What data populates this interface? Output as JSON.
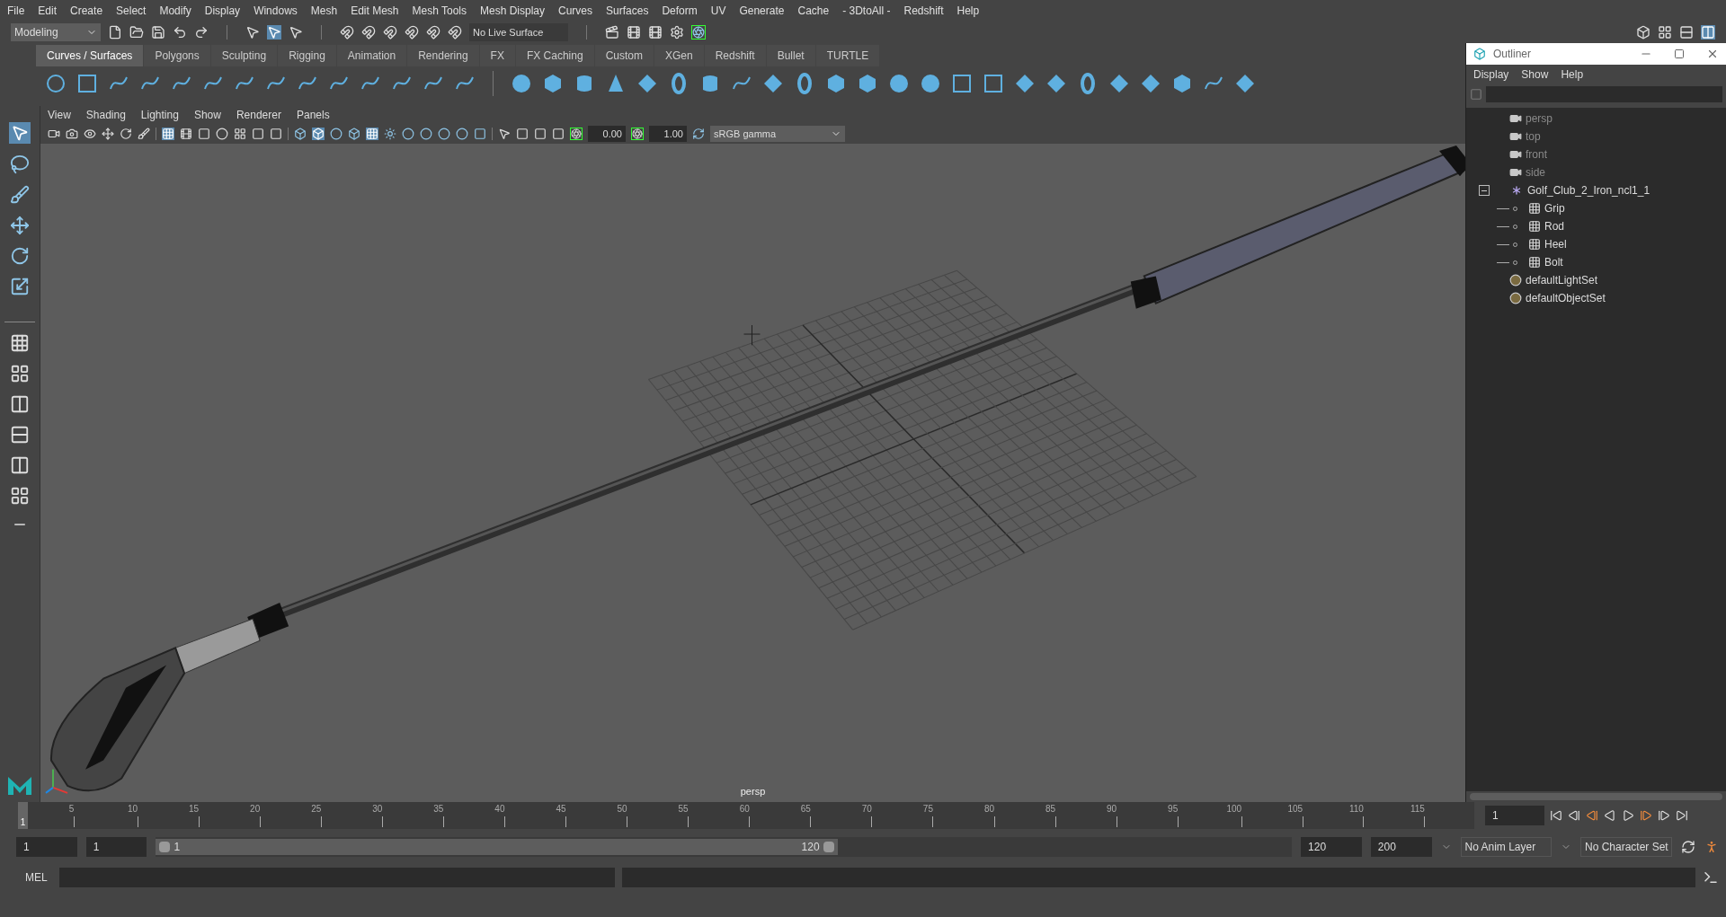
{
  "menu_bar": [
    "File",
    "Edit",
    "Create",
    "Select",
    "Modify",
    "Display",
    "Windows",
    "Mesh",
    "Edit Mesh",
    "Mesh Tools",
    "Mesh Display",
    "Curves",
    "Surfaces",
    "Deform",
    "UV",
    "Generate",
    "Cache",
    "- 3DtoAll -",
    "Redshift",
    "Help"
  ],
  "status_line": {
    "workspace": "Modeling",
    "live_surface": "No Live Surface"
  },
  "shelf_tabs": [
    {
      "label": "Curves / Surfaces",
      "selected": true
    },
    {
      "label": "Polygons",
      "selected": false
    },
    {
      "label": "Sculpting",
      "selected": false
    },
    {
      "label": "Rigging",
      "selected": false
    },
    {
      "label": "Animation",
      "selected": false
    },
    {
      "label": "Rendering",
      "selected": false
    },
    {
      "label": "FX",
      "selected": false
    },
    {
      "label": "FX Caching",
      "selected": false
    },
    {
      "label": "Custom",
      "selected": false
    },
    {
      "label": "XGen",
      "selected": false
    },
    {
      "label": "Redshift",
      "selected": false
    },
    {
      "label": "Bullet",
      "selected": false
    },
    {
      "label": "TURTLE",
      "selected": false
    }
  ],
  "viewport": {
    "menu": [
      "View",
      "Shading",
      "Lighting",
      "Show",
      "Renderer",
      "Panels"
    ],
    "exposure": "0.00",
    "gamma": "1.00",
    "color_space": "sRGB gamma",
    "camera_label": "persp"
  },
  "outliner": {
    "title": "Outliner",
    "menu": [
      "Display",
      "Show",
      "Help"
    ],
    "items": [
      {
        "kind": "camera",
        "label": "persp",
        "dimmed": true
      },
      {
        "kind": "camera",
        "label": "top",
        "dimmed": true
      },
      {
        "kind": "camera",
        "label": "front",
        "dimmed": true
      },
      {
        "kind": "camera",
        "label": "side",
        "dimmed": true
      },
      {
        "kind": "group",
        "label": "Golf_Club_2_Iron_ncl1_1",
        "dimmed": false,
        "expanded": true,
        "children": [
          {
            "kind": "mesh",
            "label": "Grip",
            "dimmed": false
          },
          {
            "kind": "mesh",
            "label": "Rod",
            "dimmed": false
          },
          {
            "kind": "mesh",
            "label": "Heel",
            "dimmed": false
          },
          {
            "kind": "mesh",
            "label": "Bolt",
            "dimmed": false
          }
        ]
      },
      {
        "kind": "set",
        "label": "defaultLightSet",
        "dimmed": false
      },
      {
        "kind": "set",
        "label": "defaultObjectSet",
        "dimmed": false
      }
    ]
  },
  "timeline": {
    "current_frame": "1",
    "ticks": [
      "5",
      "10",
      "15",
      "20",
      "25",
      "30",
      "35",
      "40",
      "45",
      "50",
      "55",
      "60",
      "65",
      "70",
      "75",
      "80",
      "85",
      "90",
      "95",
      "100",
      "105",
      "110",
      "115"
    ],
    "frame_field": "1"
  },
  "range": {
    "level": 0.6,
    "start": "1",
    "playback_start": "1",
    "slider_start": "1",
    "slider_end": "120",
    "playback_end": "120",
    "end": "200",
    "anim_layer": "No Anim Layer",
    "character_set": "No Character Set"
  },
  "command_line": {
    "label": "MEL"
  }
}
